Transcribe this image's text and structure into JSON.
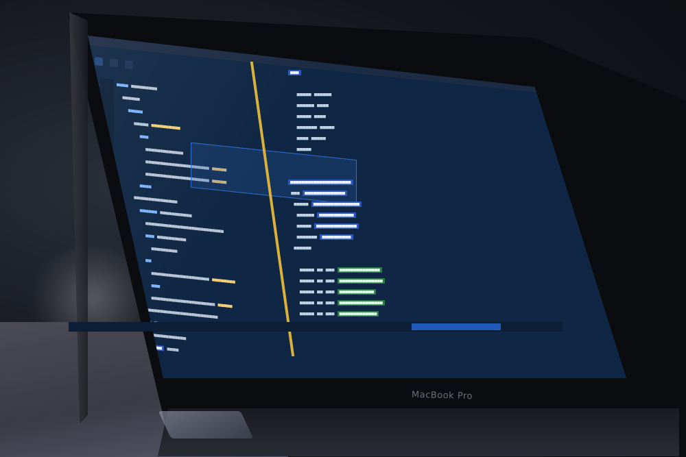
{
  "scene": {
    "description_tag": "laptop-code-editor-photo",
    "brand_label": "MacBook Pro"
  },
  "menu": {
    "items": [
      "",
      "",
      "",
      "",
      "",
      ""
    ]
  },
  "tabs": [
    {
      "label": "",
      "active": true
    },
    {
      "label": "",
      "active": false
    },
    {
      "label": "",
      "active": false
    }
  ],
  "status_bar": {
    "items": [
      "",
      "",
      ""
    ]
  },
  "colors": {
    "editor_bg": "#0f2744",
    "divider": "#d9b13b",
    "selection": "#2c57b7",
    "accent_green": "#2f7a4a"
  }
}
